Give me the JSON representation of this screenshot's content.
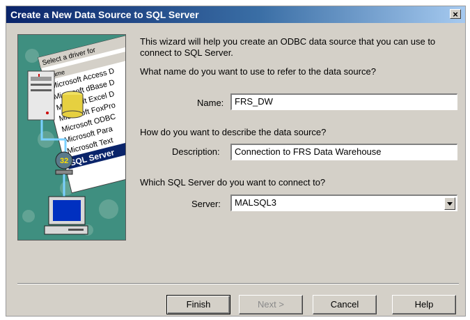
{
  "window": {
    "title": "Create a New Data Source to SQL Server"
  },
  "intro": {
    "line1": "This wizard will help you create an ODBC data source that you can use to",
    "line2": "connect to SQL Server."
  },
  "name_section": {
    "question": "What name do you want to use to refer to the data source?",
    "label": "Name:",
    "value": "FRS_DW"
  },
  "description_section": {
    "question": "How do you want to describe the data source?",
    "label": "Description:",
    "value": "Connection to FRS Data Warehouse"
  },
  "server_section": {
    "question": "Which SQL Server do you want to connect to?",
    "label": "Server:",
    "value": "MALSQL3"
  },
  "illustration": {
    "header": "Select a driver for",
    "drivers": [
      "Microsoft Access D",
      "Microsoft dBase D",
      "Microsoft Excel D",
      "Microsoft FoxPro",
      "Microsoft ODBC",
      "Microsoft Para",
      "Microsoft Text",
      "SQL Server"
    ],
    "column_header": "Name"
  },
  "buttons": {
    "finish": "Finish",
    "next": "Next >",
    "cancel": "Cancel",
    "help": "Help"
  },
  "colors": {
    "titlebar_start": "#0a246a",
    "dialog_bg": "#d4d0c8",
    "illustration_bg": "#3a8d7e",
    "selection": "#0a246a"
  }
}
